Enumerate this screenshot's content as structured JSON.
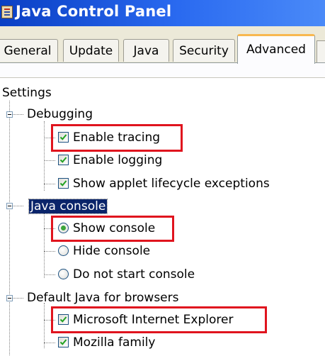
{
  "window": {
    "title": "Java Control Panel"
  },
  "tabs": [
    {
      "label": "General"
    },
    {
      "label": "Update"
    },
    {
      "label": "Java"
    },
    {
      "label": "Security"
    },
    {
      "label": "Advanced",
      "selected": true
    }
  ],
  "tree": {
    "root": "Settings",
    "groups": [
      {
        "label": "Debugging",
        "items": [
          {
            "label": "Enable tracing",
            "type": "checkbox",
            "checked": true,
            "highlighted": true
          },
          {
            "label": "Enable logging",
            "type": "checkbox",
            "checked": true
          },
          {
            "label": "Show applet lifecycle exceptions",
            "type": "checkbox",
            "checked": true
          }
        ]
      },
      {
        "label": "Java console",
        "selected": true,
        "items": [
          {
            "label": "Show console",
            "type": "radio",
            "checked": true,
            "highlighted": true
          },
          {
            "label": "Hide console",
            "type": "radio",
            "checked": false
          },
          {
            "label": "Do not start console",
            "type": "radio",
            "checked": false
          }
        ]
      },
      {
        "label": "Default Java for browsers",
        "items": [
          {
            "label": "Microsoft Internet Explorer",
            "type": "checkbox",
            "checked": true,
            "highlighted": true
          },
          {
            "label": "Mozilla family",
            "type": "checkbox",
            "checked": true
          }
        ]
      }
    ]
  },
  "colors": {
    "title_bar": "#0a3fc4",
    "selection": "#0a246a",
    "highlight_box": "#e0141e",
    "check_mark": "#21a121"
  }
}
